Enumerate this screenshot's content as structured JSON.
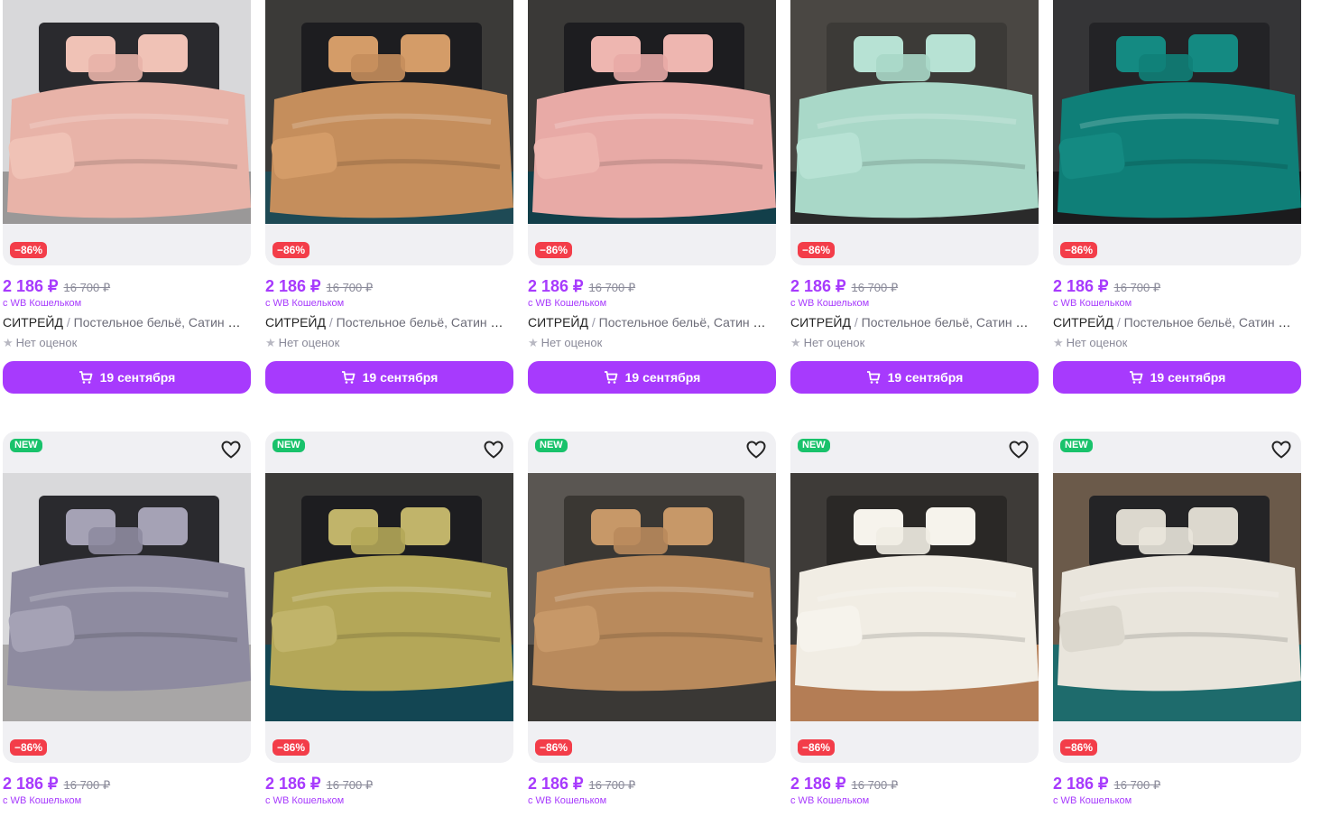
{
  "rows": [
    {
      "cards": [
        {
          "discount": "−86%",
          "price": "2 186 ₽",
          "old_price": "16 700 ₽",
          "wallet": "с WB Кошельком",
          "brand": "СИТРЕЙД",
          "title": "Постельное бельё, Сатин Жаккард",
          "rating": "Нет оценок",
          "delivery": "19 сентября",
          "colors": {
            "bed": "#e8b3a8",
            "pillow": "#f0c2b6",
            "headboard": "#2a2a2e",
            "wall": "#d8d8da",
            "floor": "#9a9898"
          }
        },
        {
          "discount": "−86%",
          "price": "2 186 ₽",
          "old_price": "16 700 ₽",
          "wallet": "с WB Кошельком",
          "brand": "СИТРЕЙД",
          "title": "Постельное бельё, Сатин Жаккард",
          "rating": "Нет оценок",
          "delivery": "19 сентября",
          "colors": {
            "bed": "#c58e5c",
            "pillow": "#d49c68",
            "headboard": "#1d1d20",
            "wall": "#3b3a38",
            "floor": "#1e4a55"
          }
        },
        {
          "discount": "−86%",
          "price": "2 186 ₽",
          "old_price": "16 700 ₽",
          "wallet": "с WB Кошельком",
          "brand": "СИТРЕЙД",
          "title": "Постельное бельё, Сатин Жаккард",
          "rating": "Нет оценок",
          "delivery": "19 сентября",
          "colors": {
            "bed": "#e8aaa6",
            "pillow": "#eeb6b0",
            "headboard": "#1d1d20",
            "wall": "#3a3937",
            "floor": "#123f4a"
          }
        },
        {
          "discount": "−86%",
          "price": "2 186 ₽",
          "old_price": "16 700 ₽",
          "wallet": "с WB Кошельком",
          "brand": "СИТРЕЙД",
          "title": "Постельное бельё, Сатин Жаккард",
          "rating": "Нет оценок",
          "delivery": "19 сентября",
          "colors": {
            "bed": "#a9d8c8",
            "pillow": "#b7e2d4",
            "headboard": "#3c3a37",
            "wall": "#4a4743",
            "floor": "#2a2a2a"
          }
        },
        {
          "discount": "−86%",
          "price": "2 186 ₽",
          "old_price": "16 700 ₽",
          "wallet": "с WB Кошельком",
          "brand": "СИТРЕЙД",
          "title": "Постельное бельё, Сатин Жаккард",
          "rating": "Нет оценок",
          "delivery": "19 сентября",
          "colors": {
            "bed": "#0f7f78",
            "pillow": "#148a82",
            "headboard": "#232326",
            "wall": "#353537",
            "floor": "#1b1b1d"
          }
        }
      ]
    },
    {
      "cards": [
        {
          "badge": "NEW",
          "discount": "−86%",
          "price": "2 186 ₽",
          "old_price": "16 700 ₽",
          "wallet": "с WB Кошельком",
          "colors": {
            "bed": "#8e8ba0",
            "pillow": "#a5a2b5",
            "headboard": "#2a2a2e",
            "wall": "#d9d9db",
            "floor": "#a8a6a6"
          }
        },
        {
          "badge": "NEW",
          "discount": "−86%",
          "price": "2 186 ₽",
          "old_price": "16 700 ₽",
          "wallet": "с WB Кошельком",
          "colors": {
            "bed": "#b4a758",
            "pillow": "#c1b46a",
            "headboard": "#1d1d20",
            "wall": "#3b3a38",
            "floor": "#134653"
          }
        },
        {
          "badge": "NEW",
          "discount": "−86%",
          "price": "2 186 ₽",
          "old_price": "16 700 ₽",
          "wallet": "с WB Кошельком",
          "colors": {
            "bed": "#b98a5c",
            "pillow": "#c79868",
            "headboard": "#3a3733",
            "wall": "#5a5652",
            "floor": "#3a3835"
          }
        },
        {
          "badge": "NEW",
          "discount": "−86%",
          "price": "2 186 ₽",
          "old_price": "16 700 ₽",
          "wallet": "с WB Кошельком",
          "colors": {
            "bed": "#f1ede4",
            "pillow": "#f6f3ec",
            "headboard": "#2a2826",
            "wall": "#3e3b38",
            "floor": "#b47d55"
          }
        },
        {
          "badge": "NEW",
          "discount": "−86%",
          "price": "2 186 ₽",
          "old_price": "16 700 ₽",
          "wallet": "с WB Кошельком",
          "colors": {
            "bed": "#e9e5dc",
            "pillow": "#dcd8ce",
            "headboard": "#242426",
            "wall": "#6b5a4a",
            "floor": "#1e6b6c"
          }
        }
      ]
    }
  ],
  "icons": {
    "favorite": "heart-icon",
    "cart": "cart-icon",
    "rating": "star-icon"
  },
  "accent": "#a73afd",
  "discount_color": "#f33d49",
  "new_color": "#19c26b"
}
